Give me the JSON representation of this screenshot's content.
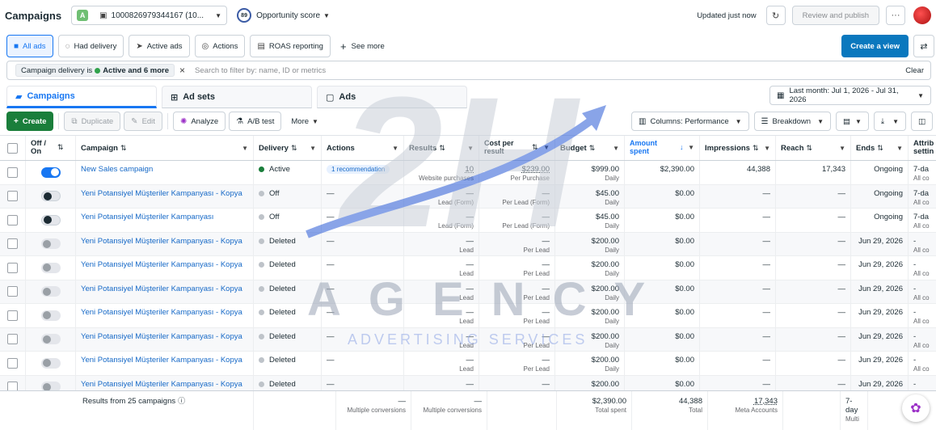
{
  "topbar": {
    "title": "Campaigns",
    "account_badge": "A",
    "account_label": "1000826979344167 (10...",
    "opportunity_score_value": "89",
    "opportunity_score_label": "Opportunity score",
    "updated": "Updated just now",
    "review_publish": "Review and publish",
    "more": "···"
  },
  "filters": {
    "tabs": [
      {
        "label": "All ads",
        "active": true,
        "icon": "folder-icon"
      },
      {
        "label": "Had delivery",
        "icon": "chat-icon"
      },
      {
        "label": "Active ads",
        "icon": "send-icon"
      },
      {
        "label": "Actions",
        "icon": "actions-icon"
      },
      {
        "label": "ROAS reporting",
        "icon": "report-icon"
      }
    ],
    "see_more": "See more",
    "create_view": "Create a view"
  },
  "search": {
    "pill_prefix": "Campaign delivery is",
    "pill_value": "Active and 6 more",
    "placeholder": "Search to filter by: name, ID or metrics",
    "clear": "Clear"
  },
  "levels": {
    "campaigns": "Campaigns",
    "adsets": "Ad sets",
    "ads": "Ads",
    "date_range": "Last month: Jul 1, 2026 - Jul 31, 2026"
  },
  "toolbar": {
    "create": "Create",
    "duplicate": "Duplicate",
    "edit": "Edit",
    "analyze": "Analyze",
    "ab_test": "A/B test",
    "more": "More",
    "columns": "Columns: Performance",
    "breakdown": "Breakdown"
  },
  "table": {
    "headers": {
      "offon": "Off / On",
      "campaign": "Campaign",
      "delivery": "Delivery",
      "actions": "Actions",
      "results": "Results",
      "cost": "Cost per result",
      "budget": "Budget",
      "amount": "Amount spent",
      "impressions": "Impressions",
      "reach": "Reach",
      "ends": "Ends",
      "attribution": "Attrib settin"
    },
    "rows": [
      {
        "toggle": "on",
        "name": "New Sales campaign",
        "delivery": "Active",
        "dot": "green",
        "action": "1 recommendation",
        "results": "10",
        "results_sub": "Website purchases",
        "cost": "$239.00",
        "cost_sub": "Per Purchase",
        "budget": "$999.00",
        "budget_sub": "Daily",
        "amount": "$2,390.00",
        "impressions": "44,388",
        "reach": "17,343",
        "ends": "Ongoing",
        "attr": "7-da",
        "attr_sub": "All co"
      },
      {
        "toggle": "off",
        "name": "Yeni Potansiyel Müşteriler Kampanyası - Kopya",
        "delivery": "Off",
        "dot": "grey",
        "action": "—",
        "results": "—",
        "results_sub": "Lead (Form)",
        "cost": "—",
        "cost_sub": "Per Lead (Form)",
        "budget": "$45.00",
        "budget_sub": "Daily",
        "amount": "$0.00",
        "impressions": "—",
        "reach": "—",
        "ends": "Ongoing",
        "attr": "7-da",
        "attr_sub": "All co"
      },
      {
        "toggle": "off",
        "name": "Yeni Potansiyel Müşteriler Kampanyası",
        "delivery": "Off",
        "dot": "grey",
        "action": "—",
        "results": "—",
        "results_sub": "Lead (Form)",
        "cost": "—",
        "cost_sub": "Per Lead (Form)",
        "budget": "$45.00",
        "budget_sub": "Daily",
        "amount": "$0.00",
        "impressions": "—",
        "reach": "—",
        "ends": "Ongoing",
        "attr": "7-da",
        "attr_sub": "All co"
      },
      {
        "toggle": "deleted",
        "name": "Yeni Potansiyel Müşteriler Kampanyası - Kopya",
        "delivery": "Deleted",
        "dot": "grey",
        "action": "—",
        "results": "—",
        "results_sub": "Lead",
        "cost": "—",
        "cost_sub": "Per Lead",
        "budget": "$200.00",
        "budget_sub": "Daily",
        "amount": "$0.00",
        "impressions": "—",
        "reach": "—",
        "ends": "Jun 29, 2026",
        "attr": "-",
        "attr_sub": "All co"
      },
      {
        "toggle": "deleted",
        "name": "Yeni Potansiyel Müşteriler Kampanyası - Kopya",
        "delivery": "Deleted",
        "dot": "grey",
        "action": "—",
        "results": "—",
        "results_sub": "Lead",
        "cost": "—",
        "cost_sub": "Per Lead",
        "budget": "$200.00",
        "budget_sub": "Daily",
        "amount": "$0.00",
        "impressions": "—",
        "reach": "—",
        "ends": "Jun 29, 2026",
        "attr": "-",
        "attr_sub": "All co"
      },
      {
        "toggle": "deleted",
        "name": "Yeni Potansiyel Müşteriler Kampanyası - Kopya",
        "delivery": "Deleted",
        "dot": "grey",
        "action": "—",
        "results": "—",
        "results_sub": "Lead",
        "cost": "—",
        "cost_sub": "Per Lead",
        "budget": "$200.00",
        "budget_sub": "Daily",
        "amount": "$0.00",
        "impressions": "—",
        "reach": "—",
        "ends": "Jun 29, 2026",
        "attr": "-",
        "attr_sub": "All co"
      },
      {
        "toggle": "deleted",
        "name": "Yeni Potansiyel Müşteriler Kampanyası - Kopya",
        "delivery": "Deleted",
        "dot": "grey",
        "action": "—",
        "results": "—",
        "results_sub": "Lead",
        "cost": "—",
        "cost_sub": "Per Lead",
        "budget": "$200.00",
        "budget_sub": "Daily",
        "amount": "$0.00",
        "impressions": "—",
        "reach": "—",
        "ends": "Jun 29, 2026",
        "attr": "-",
        "attr_sub": "All co"
      },
      {
        "toggle": "deleted",
        "name": "Yeni Potansiyel Müşteriler Kampanyası - Kopya",
        "delivery": "Deleted",
        "dot": "grey",
        "action": "—",
        "results": "—",
        "results_sub": "Lead",
        "cost": "—",
        "cost_sub": "Per Lead",
        "budget": "$200.00",
        "budget_sub": "Daily",
        "amount": "$0.00",
        "impressions": "—",
        "reach": "—",
        "ends": "Jun 29, 2026",
        "attr": "-",
        "attr_sub": "All co"
      },
      {
        "toggle": "deleted",
        "name": "Yeni Potansiyel Müşteriler Kampanyası - Kopya",
        "delivery": "Deleted",
        "dot": "grey",
        "action": "—",
        "results": "—",
        "results_sub": "Lead",
        "cost": "—",
        "cost_sub": "Per Lead",
        "budget": "$200.00",
        "budget_sub": "Daily",
        "amount": "$0.00",
        "impressions": "—",
        "reach": "—",
        "ends": "Jun 29, 2026",
        "attr": "-",
        "attr_sub": "All co"
      },
      {
        "toggle": "deleted",
        "name": "Yeni Potansiyel Müşteriler Kampanyası - Kopya",
        "delivery": "Deleted",
        "dot": "grey",
        "action": "—",
        "results": "—",
        "results_sub": "Lead",
        "cost": "—",
        "cost_sub": "Per Lead",
        "budget": "$200.00",
        "budget_sub": "Daily",
        "amount": "$0.00",
        "impressions": "—",
        "reach": "—",
        "ends": "Jun 29, 2026",
        "attr": "-",
        "attr_sub": "All co"
      }
    ]
  },
  "totals": {
    "label": "Results from 25 campaigns",
    "results": "—",
    "results_sub": "Multiple conversions",
    "cost": "—",
    "cost_sub": "Multiple conversions",
    "amount": "$2,390.00",
    "amount_sub": "Total spent",
    "impressions": "44,388",
    "impressions_sub": "Total",
    "reach": "17,343",
    "reach_sub": "Meta Accounts",
    "attr": "7-day",
    "attr_sub": "Multi"
  },
  "watermark": {
    "logo": "2H",
    "line1": "AGENCY",
    "line2": "ADVERTISING SERVICES"
  },
  "colors": {
    "primary": "#1877f2",
    "create_green": "#1a7e3b",
    "active_dot": "#1a7e3b",
    "link": "#1669c7"
  }
}
